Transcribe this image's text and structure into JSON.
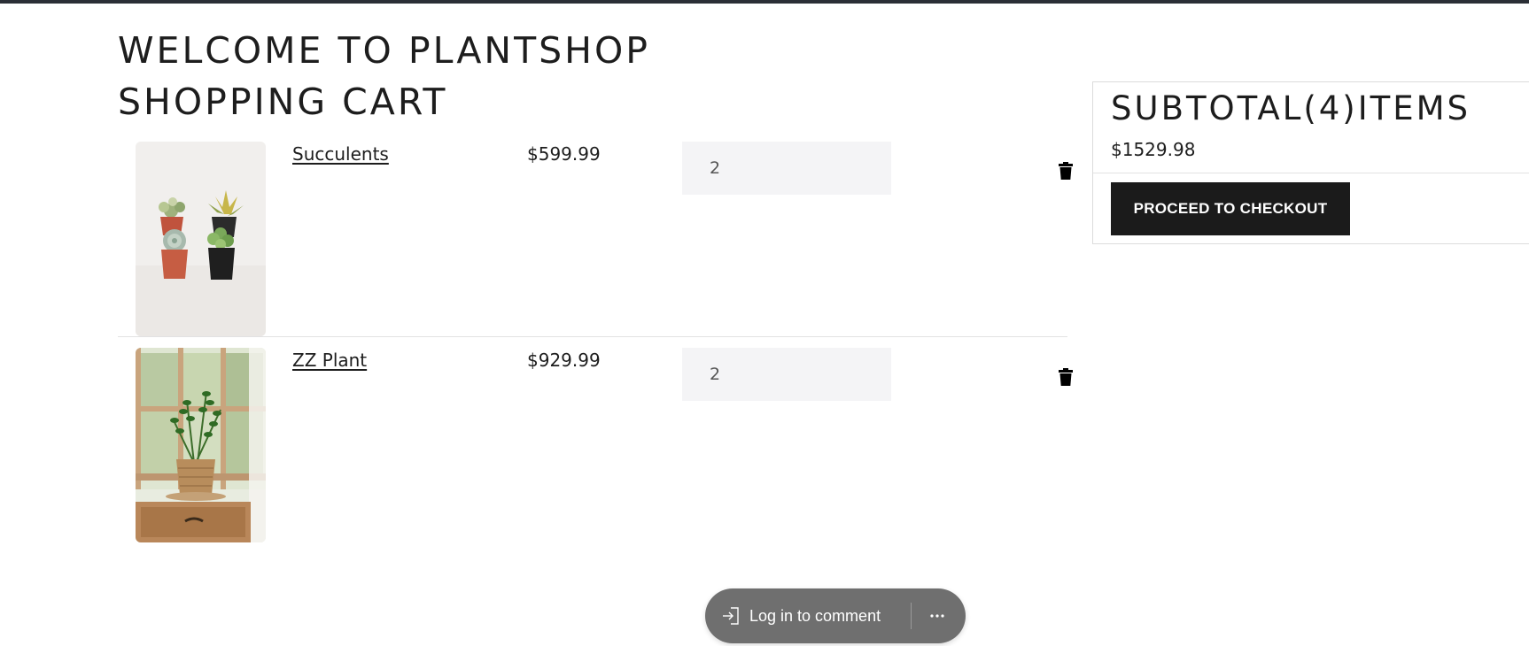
{
  "page": {
    "welcome_title": "WELCOME TO PLANTSHOP",
    "cart_title": "SHOPPING CART"
  },
  "cart": {
    "items": [
      {
        "name": "Succulents",
        "price": "$599.99",
        "quantity": "2",
        "image": "succulents-photo"
      },
      {
        "name": "ZZ Plant",
        "price": "$929.99",
        "quantity": "2",
        "image": "zz-plant-photo"
      }
    ]
  },
  "summary": {
    "title": "SUBTOTAL(4)ITEMS",
    "amount": "$1529.98",
    "checkout_label": "PROCEED TO CHECKOUT"
  },
  "comment_bar": {
    "login_label": "Log in to comment",
    "more_icon": "ellipsis-icon",
    "login_icon": "sign-in-icon"
  },
  "colors": {
    "top_bar": "#2b2f36",
    "checkout_button": "#1b1b1b",
    "input_background": "#f4f4f6",
    "comment_pill": "#6f6f6f"
  }
}
